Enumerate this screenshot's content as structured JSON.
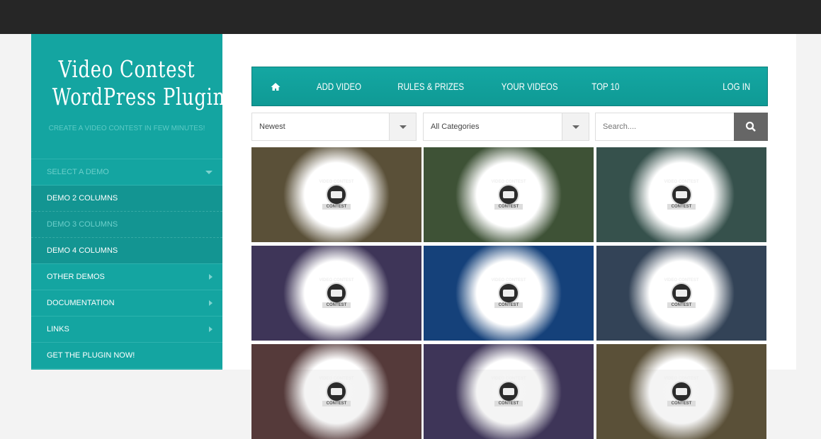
{
  "sidebar": {
    "title_line1": "Video Contest",
    "title_line2": "WordPress Plugin",
    "subtitle": "CREATE A VIDEO CONTEST IN FEW MINUTES!",
    "items": [
      {
        "label": "SELECT A DEMO"
      },
      {
        "label": "DEMO 2 COLUMNS"
      },
      {
        "label": "DEMO 3 COLUMNS"
      },
      {
        "label": "DEMO 4 COLUMNS"
      },
      {
        "label": "OTHER DEMOS"
      },
      {
        "label": "DOCUMENTATION"
      },
      {
        "label": "LINKS"
      },
      {
        "label": "GET THE PLUGIN NOW!"
      }
    ]
  },
  "nav": {
    "items": [
      "ADD VIDEO",
      "RULES & PRIZES",
      "YOUR VIDEOS",
      "TOP 10"
    ],
    "login": "LOG IN"
  },
  "filters": {
    "sort": "Newest",
    "category": "All Categories",
    "search_placeholder": "Search...."
  },
  "badge": {
    "top": "VIDEO CONTEST",
    "ribbon": "CONTEST"
  },
  "tiles": [
    "#5a5038",
    "#3e5236",
    "#36514c",
    "#3e3558",
    "#15417a",
    "#334357",
    "#553a3a",
    "#3e3558",
    "#5a5038"
  ]
}
